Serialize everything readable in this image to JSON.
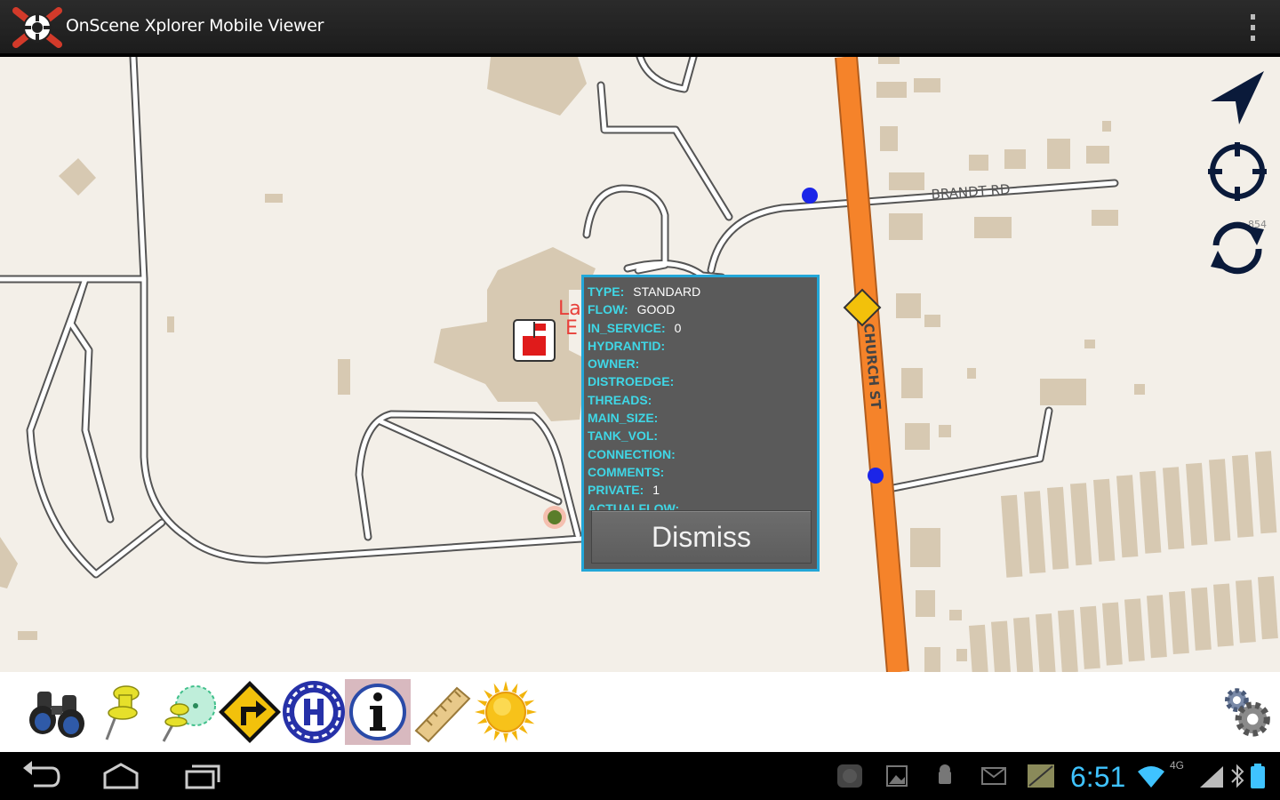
{
  "app": {
    "title": "OnScene Xplorer Mobile Viewer"
  },
  "map": {
    "labels": {
      "road_brandt": "BRANDT RD",
      "road_church": "CHURCH ST",
      "route_shield": "",
      "number_label": "854",
      "poi_partial_1": "La",
      "poi_partial_2": "E"
    }
  },
  "popup": {
    "fields": [
      {
        "key": "TYPE:",
        "value": "STANDARD"
      },
      {
        "key": "FLOW:",
        "value": "GOOD"
      },
      {
        "key": "IN_SERVICE:",
        "value": "0"
      },
      {
        "key": "HYDRANTID:",
        "value": ""
      },
      {
        "key": "OWNER:",
        "value": ""
      },
      {
        "key": "DISTROEDGE:",
        "value": ""
      },
      {
        "key": "THREADS:",
        "value": ""
      },
      {
        "key": "MAIN_SIZE:",
        "value": ""
      },
      {
        "key": "TANK_VOL:",
        "value": ""
      },
      {
        "key": "CONNECTION:",
        "value": ""
      },
      {
        "key": "COMMENTS:",
        "value": ""
      },
      {
        "key": "PRIVATE:",
        "value": "1"
      },
      {
        "key": "ACTUALFLOW:",
        "value": ""
      }
    ],
    "dismiss_label": "Dismiss"
  },
  "toolbar": {
    "tools": [
      {
        "name": "binoculars-tool",
        "icon": "binoculars-icon"
      },
      {
        "name": "pushpin-tool",
        "icon": "pushpin-icon"
      },
      {
        "name": "radius-pin-tool",
        "icon": "radius-pin-icon"
      },
      {
        "name": "directions-tool",
        "icon": "turn-sign-icon"
      },
      {
        "name": "hospital-tool",
        "icon": "hospital-icon"
      },
      {
        "name": "info-tool",
        "icon": "info-icon"
      },
      {
        "name": "measure-tool",
        "icon": "ruler-icon"
      },
      {
        "name": "daylight-tool",
        "icon": "sun-icon"
      }
    ],
    "settings_icon": "gears-icon"
  },
  "status_bar": {
    "time": "6:51",
    "network": "4G"
  },
  "colors": {
    "popup_accent": "#23a7d8",
    "field_key": "#3fd7e6",
    "major_road": "#f5832a",
    "building": "#d7c9b2",
    "clock": "#3fc3ff"
  }
}
